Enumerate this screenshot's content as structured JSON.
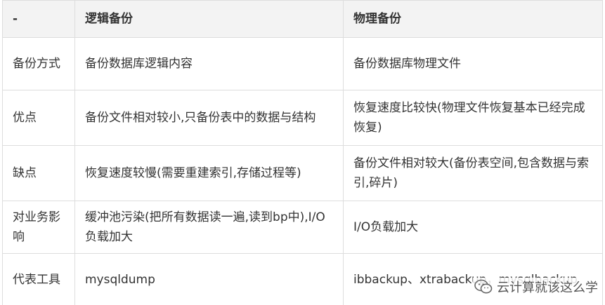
{
  "table": {
    "headers": [
      "-",
      "逻辑备份",
      "物理备份"
    ],
    "rows": [
      [
        "备份方式",
        "备份数据库逻辑内容",
        "备份数据库物理文件"
      ],
      [
        "优点",
        "备份文件相对较小,只备份表中的数据与结构",
        "恢复速度比较快(物理文件恢复基本已经完成恢复)"
      ],
      [
        "缺点",
        "恢复速度较慢(需要重建索引,存储过程等)",
        "备份文件相对较大(备份表空间,包含数据与索引,碎片)"
      ],
      [
        "对业务影响",
        "缓冲池污染(把所有数据读一遍,读到bp中),I/O负载加大",
        "I/O负载加大"
      ],
      [
        "代表工具",
        "mysqldump",
        "ibbackup、xtrabackup，mysqlbackup"
      ]
    ]
  },
  "watermark": {
    "text": "云计算就该这么学",
    "icon": "wechat-icon"
  }
}
